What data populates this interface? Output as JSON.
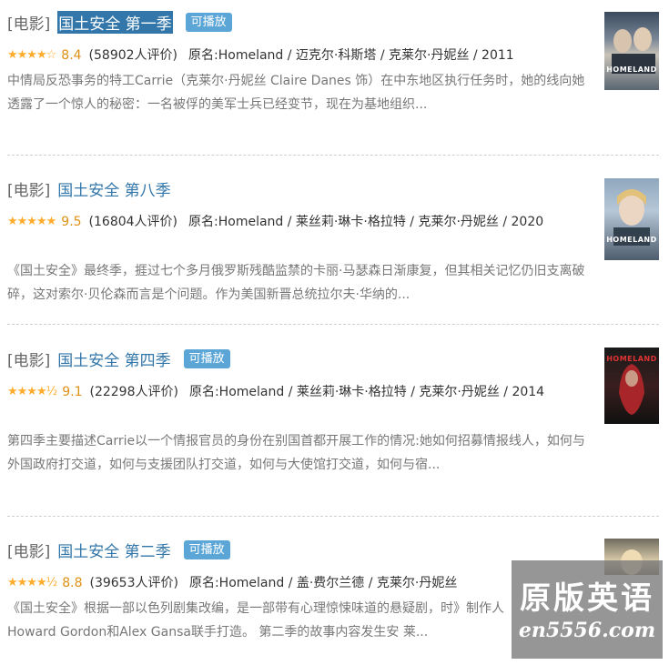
{
  "items": [
    {
      "category": "[电影]",
      "title": "国土安全 第一季",
      "playable": "可播放",
      "stars": "★★★★☆",
      "score": "8.4",
      "votes": "(58902人评价)",
      "meta": "原名:Homeland / 迈克尔·科斯塔 / 克莱尔·丹妮丝 / 2011",
      "desc": "中情局反恐事务的特工Carrie（克莱尔·丹妮丝 Claire Danes 饰）在中东地区执行任务时，她的线向她透露了一个惊人的秘密：一名被俘的美军士兵已经变节，现在为基地组织...",
      "poster_label": "HOMELAND"
    },
    {
      "category": "[电影]",
      "title": "国土安全 第八季",
      "playable": "",
      "stars": "★★★★★",
      "score": "9.5",
      "votes": "(16804人评价)",
      "meta": "原名:Homeland / 莱丝莉·琳卡·格拉特 / 克莱尔·丹妮丝 / 2020",
      "desc": "《国土安全》最终季，捱过七个多月俄罗斯残酷监禁的卡丽·马瑟森日渐康复，但其相关记忆仍旧支离破碎，这对索尔·贝伦森而言是个问题。作为美国新晋总统拉尔夫·华纳的...",
      "poster_label": "HOMELAND"
    },
    {
      "category": "[电影]",
      "title": "国土安全 第四季",
      "playable": "可播放",
      "stars": "★★★★½",
      "score": "9.1",
      "votes": "(22298人评价)",
      "meta": "原名:Homeland / 莱丝莉·琳卡·格拉特 / 克莱尔·丹妮丝 / 2014",
      "desc": "第四季主要描述Carrie以一个情报官员的身份在别国首都开展工作的情况:她如何招募情报线人，如何与外国政府打交道，如何与支援团队打交道，如何与大使馆打交道，如何与宿...",
      "poster_label": "HOMELAND"
    },
    {
      "category": "[电影]",
      "title": "国土安全 第二季",
      "playable": "可播放",
      "stars": "★★★★½",
      "score": "8.8",
      "votes": "(39653人评价)",
      "meta": "原名:Homeland / 盖·费尔兰德 / 克莱尔·丹妮丝",
      "desc": "《国土安全》根据一部以色列剧集改编，是一部带有心理惊悚味道的悬疑剧，时》制作人Howard Gordon和Alex Gansa联手打造。 第二季的故事内容发生安 莱...",
      "poster_label": ""
    }
  ],
  "watermark": {
    "line1": "原版英语",
    "line2": "en5556.com"
  },
  "colors": {
    "link": "#3377aa",
    "badge": "#5ba6d6",
    "star": "#ffac2d",
    "score": "#e09015"
  }
}
